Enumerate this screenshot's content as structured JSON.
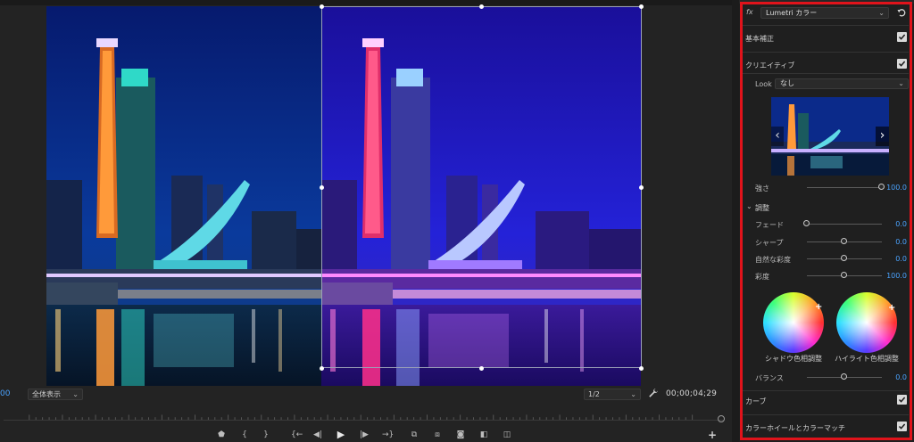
{
  "monitor": {
    "timecode_left": "00",
    "zoom_select": "全体表示",
    "resolution_select": "1/2",
    "timecode_right": "00;00;04;29",
    "transport_buttons": [
      {
        "name": "marker-icon",
        "glyph": "⬟"
      },
      {
        "name": "mark-in-icon",
        "glyph": "{"
      },
      {
        "name": "mark-out-icon",
        "glyph": "}"
      },
      {
        "name": "go-to-in-icon",
        "glyph": "{←"
      },
      {
        "name": "step-back-icon",
        "glyph": "◀|"
      },
      {
        "name": "play-icon",
        "glyph": "▶"
      },
      {
        "name": "step-forward-icon",
        "glyph": "|▶"
      },
      {
        "name": "go-to-out-icon",
        "glyph": "→}"
      },
      {
        "name": "insert-icon",
        "glyph": "⧉"
      },
      {
        "name": "overwrite-icon",
        "glyph": "⧈"
      },
      {
        "name": "camera-icon",
        "glyph": "◙"
      },
      {
        "name": "compare-icon",
        "glyph": "◧"
      },
      {
        "name": "comparison-view-icon",
        "glyph": "◫"
      }
    ],
    "add_button": "+"
  },
  "lumetri": {
    "fx_label": "fx",
    "effect_name": "Lumetri カラー",
    "sections": {
      "basic": "基本補正",
      "creative": "クリエイティブ",
      "curves": "カーブ",
      "wheels_match": "カラーホイールとカラーマッチ"
    },
    "look_label": "Look",
    "look_value": "なし",
    "intensity": {
      "label": "強さ",
      "value": "100.0",
      "fraction": 1.0
    },
    "adjust_title": "調整",
    "adjust": [
      {
        "label": "フェード",
        "value": "0.0",
        "fraction": 0.0
      },
      {
        "label": "シャープ",
        "value": "0.0",
        "fraction": 0.5
      },
      {
        "label": "自然な彩度",
        "value": "0.0",
        "fraction": 0.5
      },
      {
        "label": "彩度",
        "value": "100.0",
        "fraction": 0.5
      }
    ],
    "shadow_wheel_label": "シャドウ色相調整",
    "highlight_wheel_label": "ハイライト色相調整",
    "balance": {
      "label": "バランス",
      "value": "0.0",
      "fraction": 0.5
    }
  },
  "colors": {
    "accent": "#4aa3ff",
    "highlight_frame": "#e0131b"
  }
}
